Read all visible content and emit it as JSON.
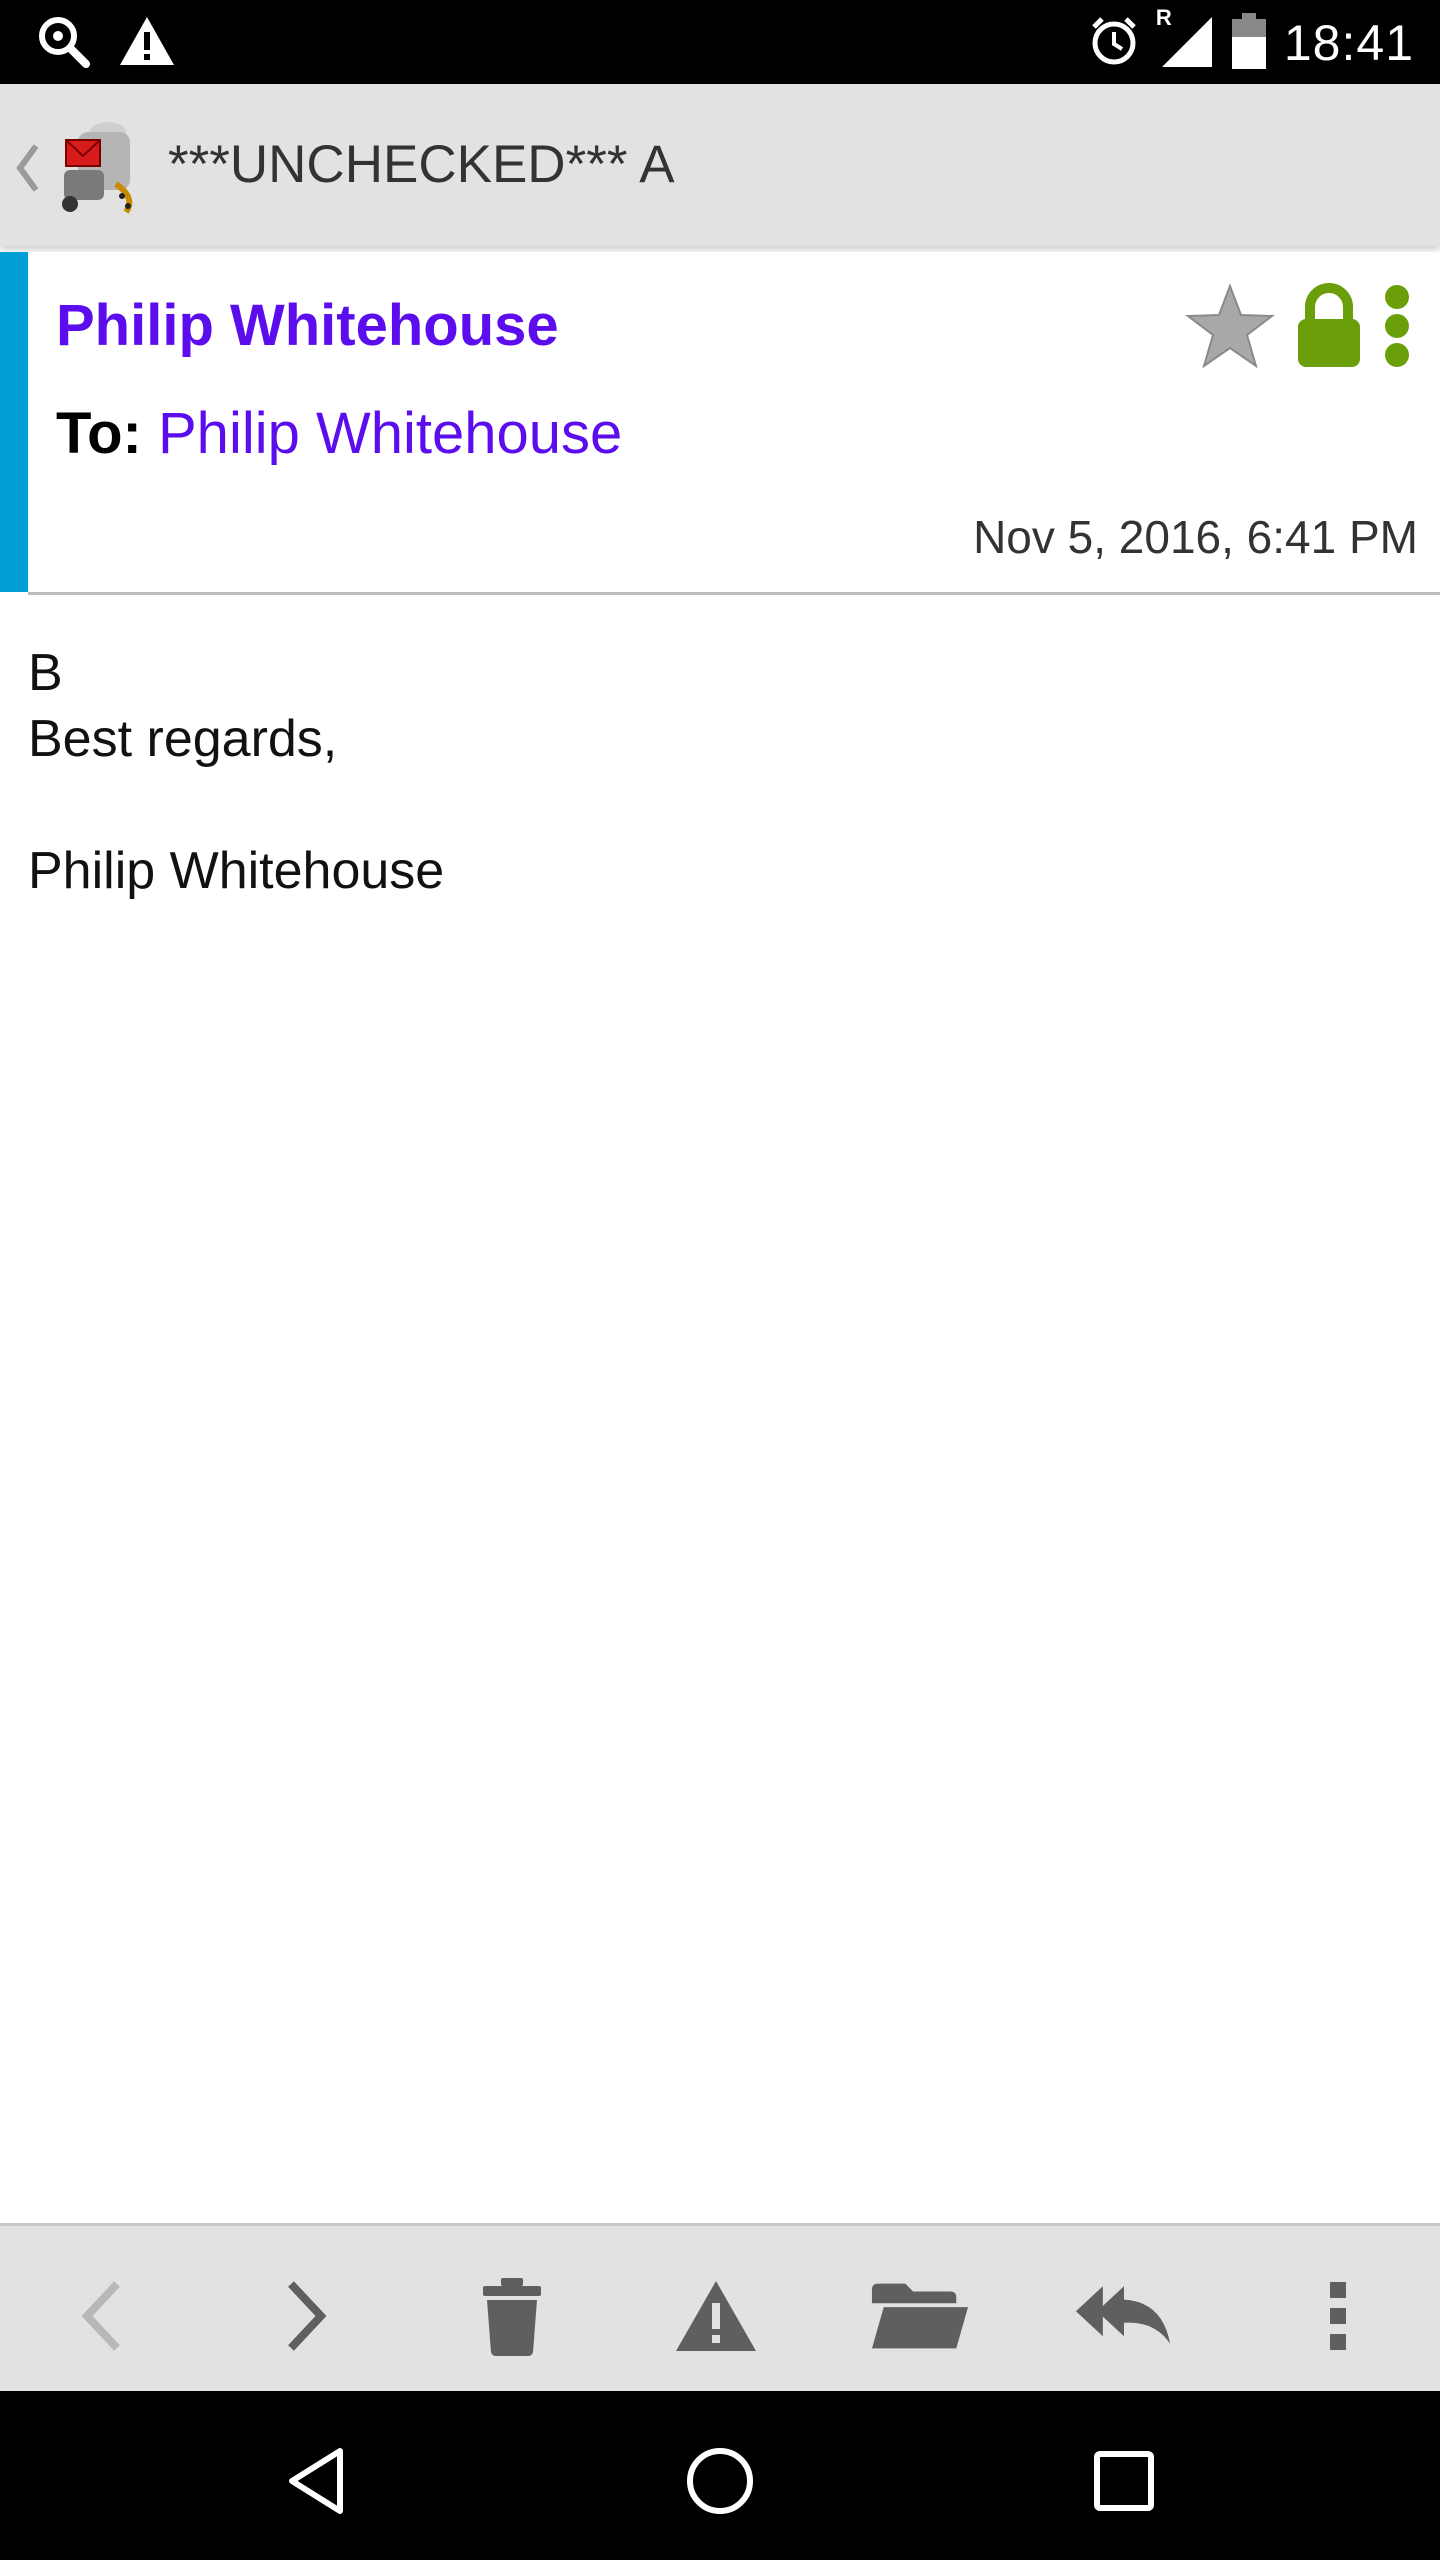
{
  "status_bar": {
    "time": "18:41",
    "roaming_indicator": "R",
    "icons": [
      "search-key-icon",
      "warning-icon",
      "alarm-icon",
      "signal-icon",
      "battery-icon"
    ]
  },
  "action_bar": {
    "title": "***UNCHECKED*** A",
    "icons": [
      "back-chevron-icon",
      "k9-mail-logo"
    ]
  },
  "message": {
    "sender": "Philip Whitehouse",
    "to_label": "To:",
    "to_name": "Philip Whitehouse",
    "date": "Nov 5, 2016, 6:41 PM",
    "body_lines": [
      "B",
      "Best regards,",
      "",
      "Philip Whitehouse"
    ],
    "icons": [
      "star-icon",
      "lock-icon",
      "more-dots-icon"
    ]
  },
  "colors": {
    "accent": "#009fd4",
    "link": "#5b0dee",
    "secure": "#6a9f0a",
    "toolbar_bg": "#e2e2e2"
  },
  "toolbar": {
    "icons": [
      "previous-icon",
      "next-icon",
      "delete-icon",
      "spam-icon",
      "move-folder-icon",
      "reply-all-icon",
      "overflow-menu-icon"
    ]
  },
  "nav_bar": {
    "icons": [
      "nav-back-icon",
      "nav-home-icon",
      "nav-recents-icon"
    ]
  }
}
